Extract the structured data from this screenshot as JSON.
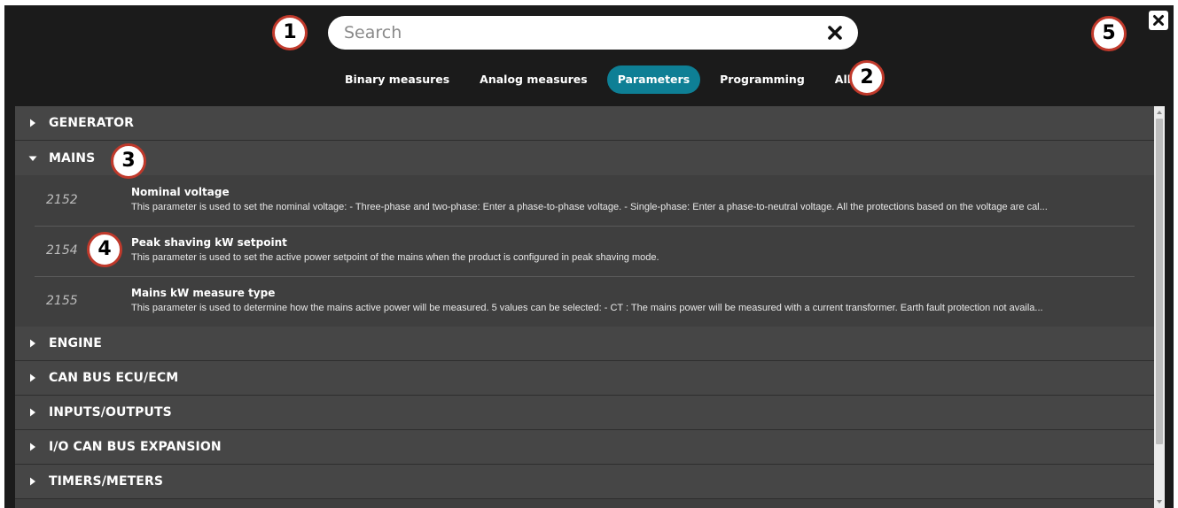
{
  "search": {
    "placeholder": "Search",
    "value": ""
  },
  "tabs": [
    {
      "label": "Binary measures",
      "active": false
    },
    {
      "label": "Analog measures",
      "active": false
    },
    {
      "label": "Parameters",
      "active": true
    },
    {
      "label": "Programming",
      "active": false
    },
    {
      "label": "All",
      "active": false
    }
  ],
  "sections": {
    "generator": {
      "title": "GENERATOR",
      "expanded": false
    },
    "mains": {
      "title": "MAINS",
      "expanded": true,
      "params": [
        {
          "id": "2152",
          "name": "Nominal voltage",
          "description": "This parameter is used to set the nominal voltage: - Three-phase and two-phase: Enter a phase-to-phase voltage. - Single-phase: Enter a phase-to-neutral voltage. All the protections based on the voltage are cal..."
        },
        {
          "id": "2154",
          "name": "Peak shaving kW setpoint",
          "description": "This parameter is used to set the active power setpoint of the mains when the product is configured in peak shaving mode."
        },
        {
          "id": "2155",
          "name": "Mains kW measure type",
          "description": "This parameter is used to determine how the mains active power will be measured. 5 values can be selected: - CT : The mains power will be measured with a current transformer. Earth fault protection not availa..."
        }
      ]
    },
    "engine": {
      "title": "ENGINE",
      "expanded": false
    },
    "canbus": {
      "title": "CAN BUS ECU/ECM",
      "expanded": false
    },
    "io": {
      "title": "INPUTS/OUTPUTS",
      "expanded": false
    },
    "iocan": {
      "title": "I/O CAN BUS EXPANSION",
      "expanded": false
    },
    "timers": {
      "title": "TIMERS/METERS",
      "expanded": false
    }
  },
  "badges": [
    "1",
    "2",
    "3",
    "4",
    "5"
  ],
  "colors": {
    "background": "#1b1b1b",
    "active_tab": "#0e7f95",
    "section_bg": "#464646",
    "badge_border": "#c0392b"
  },
  "icons": {
    "clear": "close-icon",
    "window_close": "close-icon",
    "collapsed": "caret-right-icon",
    "expanded": "caret-down-icon"
  }
}
